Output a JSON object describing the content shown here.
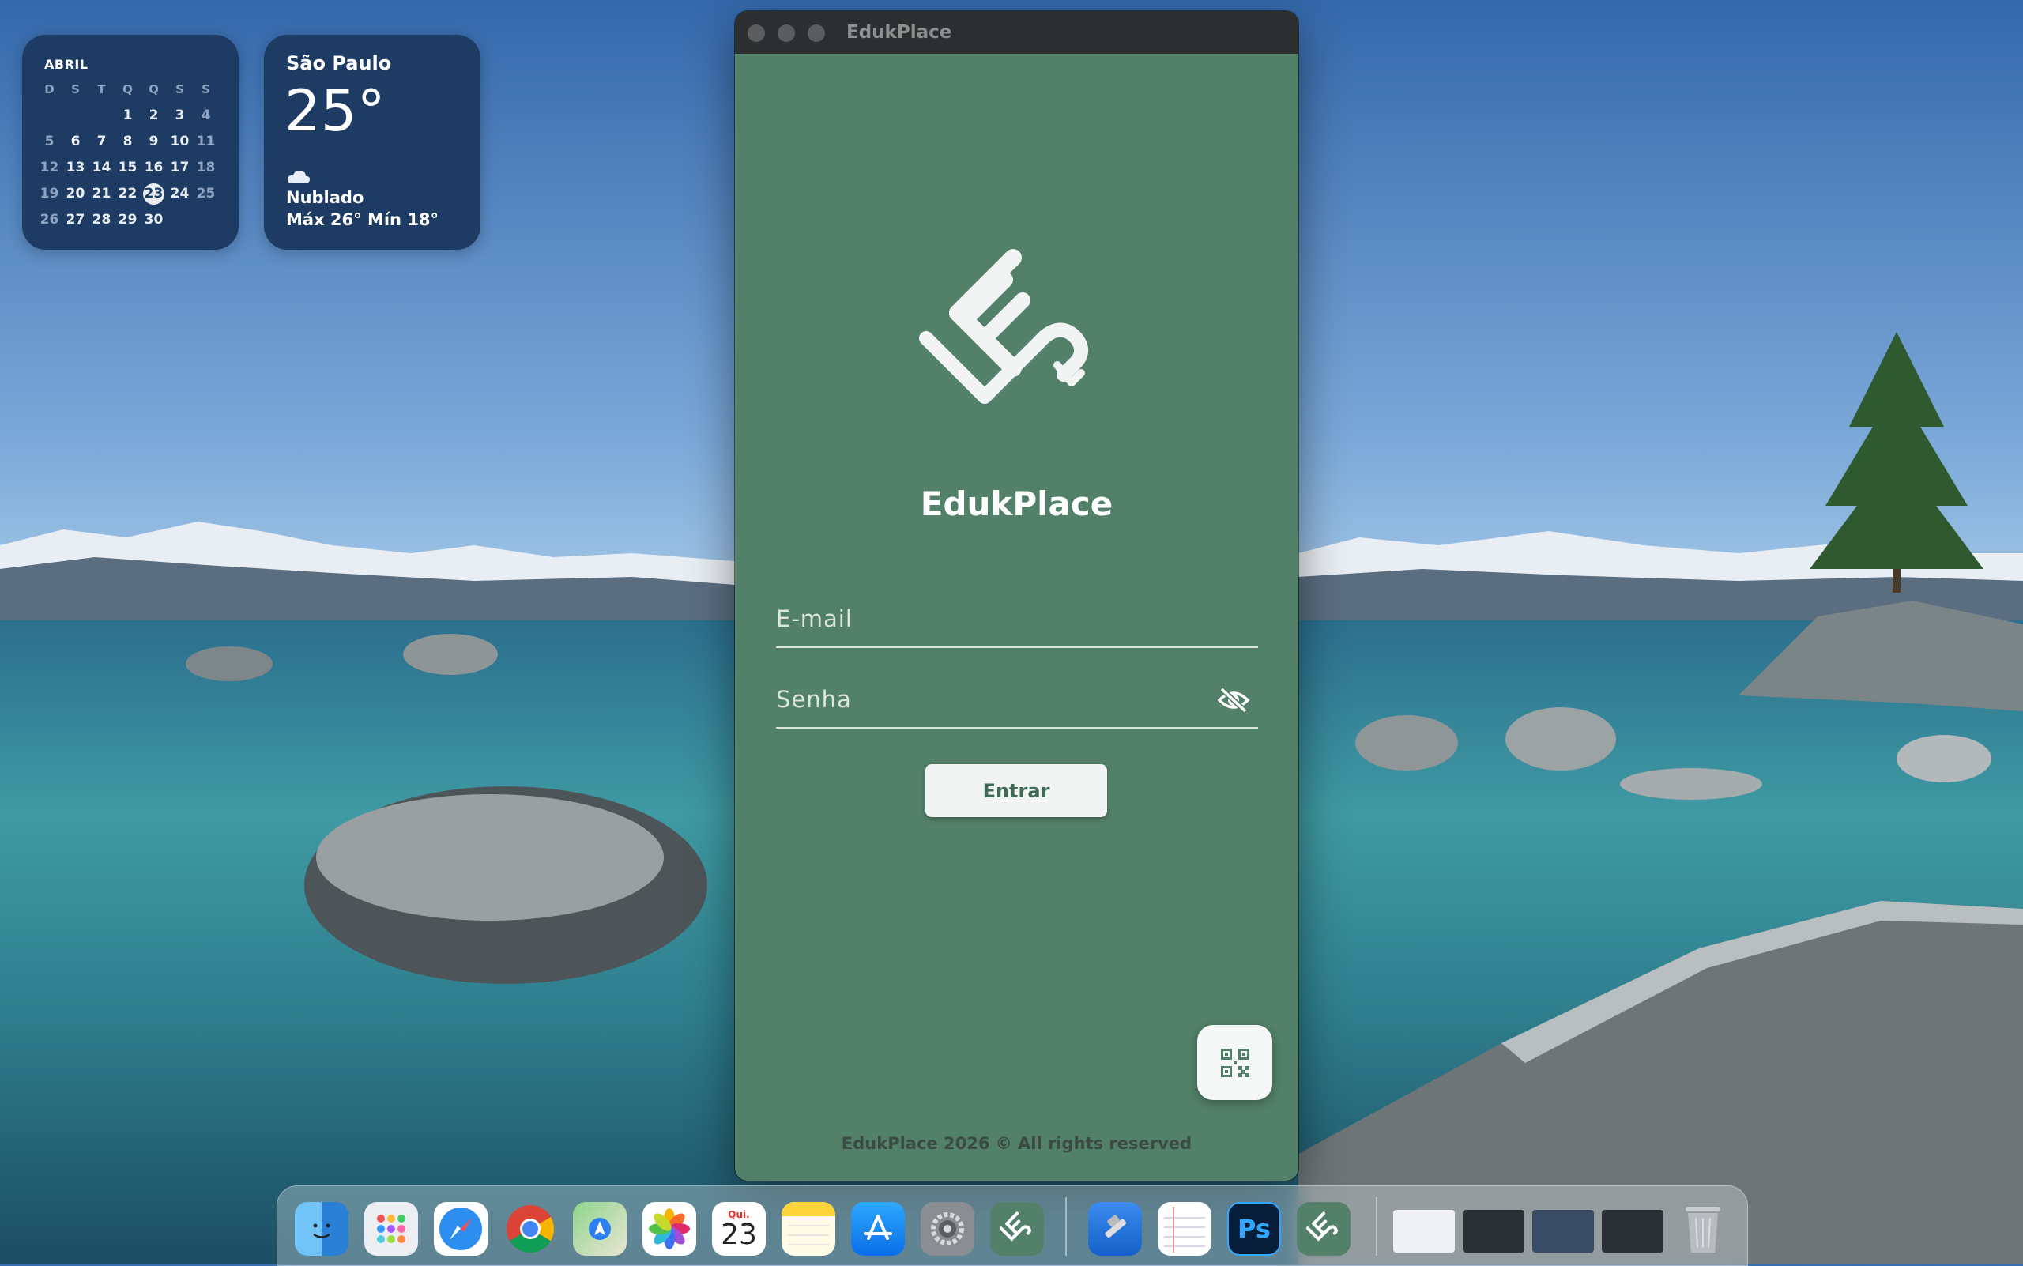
{
  "calendar_widget": {
    "month": "ABRIL",
    "weekday_headers": [
      "D",
      "S",
      "T",
      "Q",
      "Q",
      "S",
      "S"
    ],
    "weeks": [
      [
        "",
        "",
        "",
        "1",
        "2",
        "3",
        "4"
      ],
      [
        "5",
        "6",
        "7",
        "8",
        "9",
        "10",
        "11"
      ],
      [
        "12",
        "13",
        "14",
        "15",
        "16",
        "17",
        "18"
      ],
      [
        "19",
        "20",
        "21",
        "22",
        "23",
        "24",
        "25"
      ],
      [
        "26",
        "27",
        "28",
        "29",
        "30",
        "",
        ""
      ]
    ],
    "today": "23"
  },
  "weather_widget": {
    "city": "São Paulo",
    "temperature": "25°",
    "condition": "Nublado",
    "range": "Máx 26° Mín 18°",
    "icon": "cloud-icon"
  },
  "window": {
    "title": "EdukPlace"
  },
  "login": {
    "app_name": "EdukPlace",
    "email_placeholder": "E-mail",
    "password_placeholder": "Senha",
    "submit_label": "Entrar",
    "footer": "EdukPlace 2026 © All rights reserved"
  },
  "dock": {
    "calendar_icon_month": "Qui.",
    "calendar_icon_day": "23",
    "apps": [
      "finder-icon",
      "launchpad-icon",
      "safari-icon",
      "chrome-icon",
      "maps-icon",
      "photos-icon",
      "calendar-icon",
      "notes-icon",
      "app-store-icon",
      "system-settings-icon",
      "edukplace-icon",
      "xcode-icon",
      "textedit-icon",
      "photoshop-icon",
      "edukplace-icon",
      "trash-icon"
    ],
    "photoshop_label": "Ps"
  },
  "colors": {
    "app_background": "#528069",
    "widget_background": "#1d3b63",
    "button_text": "#3f6b56"
  }
}
